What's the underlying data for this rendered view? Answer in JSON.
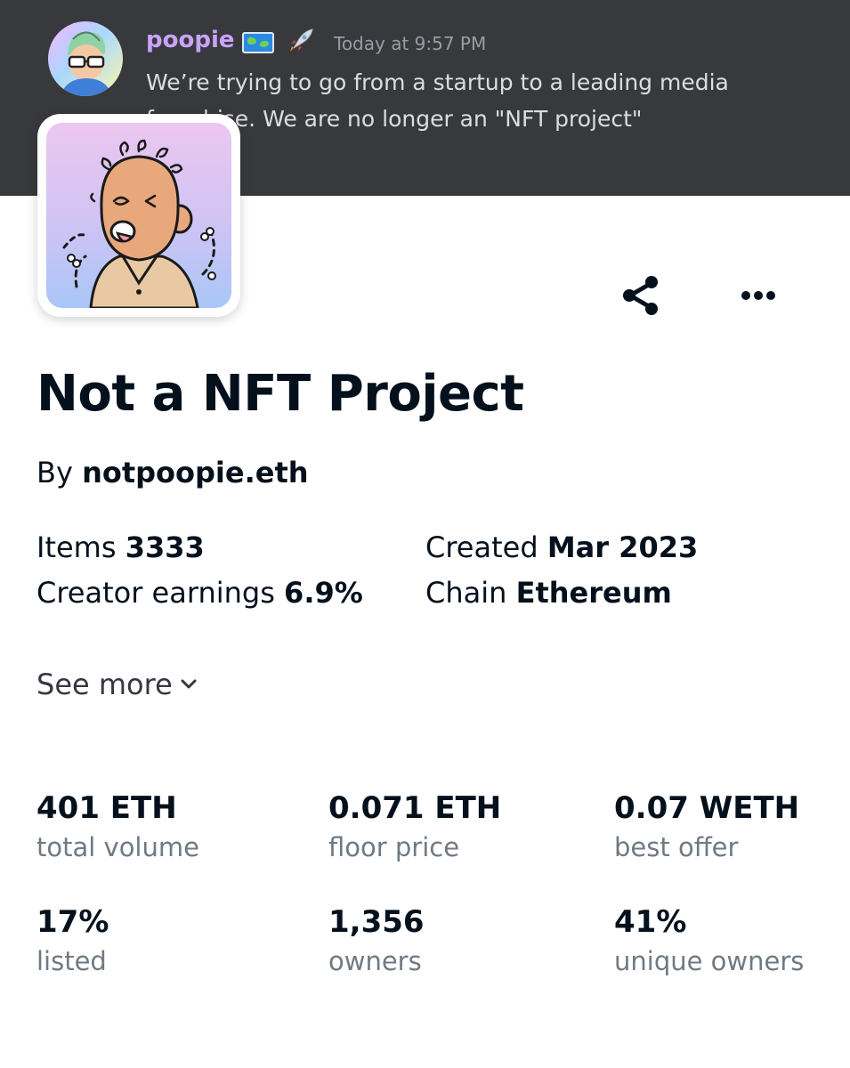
{
  "discord": {
    "username": "poopie",
    "timestamp": "Today at 9:57 PM",
    "message": "We’re trying to go from a startup to a leading media franchise. We are no longer an \"NFT project\"",
    "icons": [
      "world-map-icon",
      "rocket-icon"
    ]
  },
  "collection": {
    "title": "Not a NFT Project",
    "by_label": "By",
    "creator": "notpoopie.eth",
    "details": {
      "items_label": "Items",
      "items_value": "3333",
      "created_label": "Created",
      "created_value": "Mar 2023",
      "earnings_label": "Creator earnings",
      "earnings_value": "6.9%",
      "chain_label": "Chain",
      "chain_value": "Ethereum"
    },
    "see_more": "See more"
  },
  "stats": [
    {
      "value": "401 ETH",
      "label": "total volume"
    },
    {
      "value": "0.071 ETH",
      "label": "floor price"
    },
    {
      "value": "0.07 WETH",
      "label": "best offer"
    },
    {
      "value": "17%",
      "label": "listed"
    },
    {
      "value": "1,356",
      "label": "owners"
    },
    {
      "value": "41%",
      "label": "unique owners"
    }
  ],
  "icons": [
    "share-icon",
    "more-icon",
    "chevron-down-icon"
  ],
  "colors": {
    "banner_bg": "#38393d",
    "username": "#c9a3ff",
    "text_primary": "#04111d",
    "text_secondary": "#707a83"
  }
}
